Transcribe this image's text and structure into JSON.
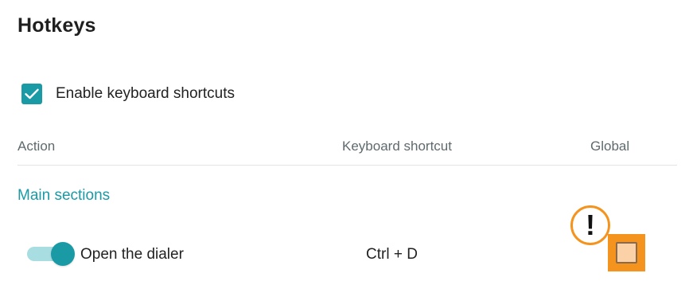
{
  "page": {
    "title": "Hotkeys"
  },
  "settings": {
    "enable_shortcuts": {
      "label": "Enable keyboard shortcuts",
      "checked": true
    }
  },
  "table": {
    "headers": {
      "action": "Action",
      "shortcut": "Keyboard shortcut",
      "global": "Global"
    },
    "sections": [
      {
        "title": "Main sections",
        "rows": [
          {
            "enabled": true,
            "action": "Open the dialer",
            "shortcut": "Ctrl + D",
            "global": false,
            "warning": "!"
          }
        ]
      }
    ]
  },
  "colors": {
    "accent": "#1a9aa5",
    "accent_light": "#a8dde1",
    "highlight": "#f4931e",
    "checkbox_fill": "#fbd2a8",
    "header_text": "#5f6a6e"
  },
  "icons": {
    "enable_checkbox": "check-icon",
    "warning_badge": "exclamation-icon"
  }
}
